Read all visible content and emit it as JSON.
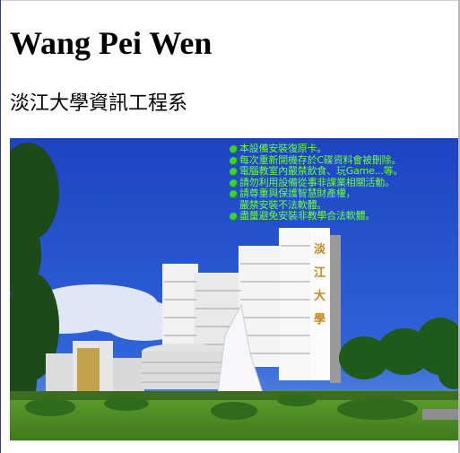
{
  "page": {
    "title": "Wang Pei Wen",
    "subtitle": "淡江大學資訊工程系"
  },
  "photo": {
    "building_sign": "淡江大學",
    "notice": {
      "items": [
        "本設備安裝復原卡。",
        "每次重新開機存於C碟資料會被刪除。",
        "電腦教室內嚴禁飲食、玩Game...等。",
        "請勿利用設備從事非課業相關活動。",
        "請尊重與保護智慧財產權，",
        "盡量避免安裝非教學合法軟體。"
      ],
      "continuation": "嚴禁安裝不法軟體。"
    }
  },
  "colors": {
    "sky": "#1f49c9",
    "notice_text": "#6cff3a",
    "frame_left": "#2c3aa8"
  }
}
